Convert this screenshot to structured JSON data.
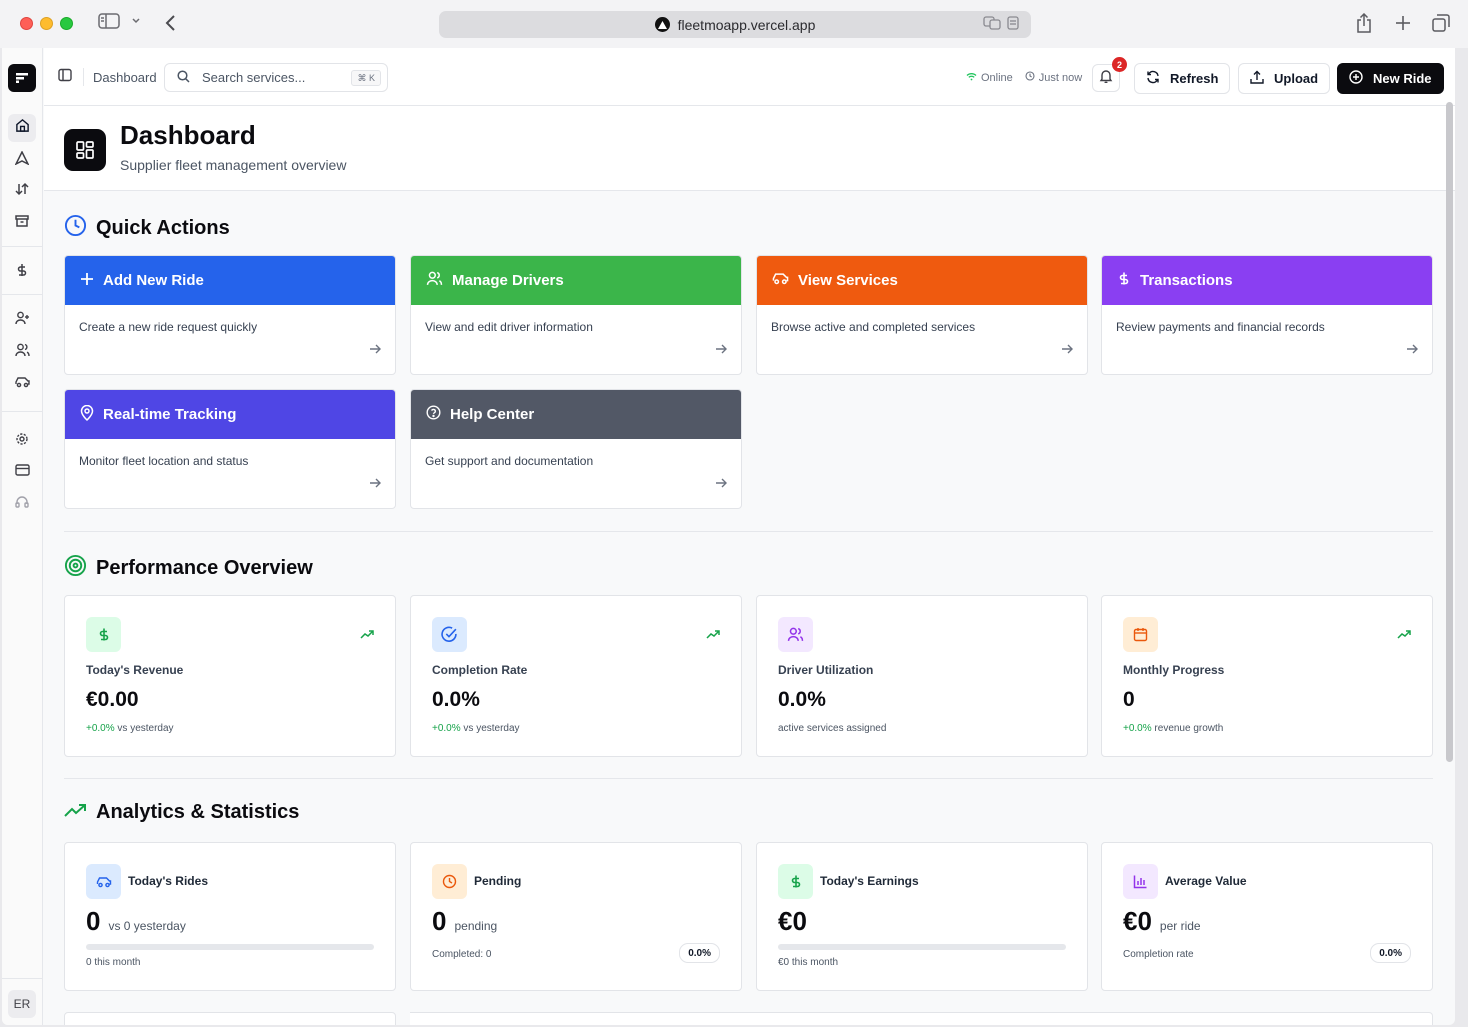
{
  "browser": {
    "url": "fleetmoapp.vercel.app"
  },
  "sidebar": {
    "avatar_initials": "ER",
    "items": [
      {
        "icon": "home-icon",
        "active": true
      },
      {
        "icon": "navigation-icon"
      },
      {
        "icon": "arrows-up-down-icon"
      },
      {
        "icon": "archive-icon"
      },
      {
        "icon": "dollar-icon"
      },
      {
        "icon": "user-plus-icon"
      },
      {
        "icon": "users-icon"
      },
      {
        "icon": "car-icon"
      },
      {
        "icon": "gear-icon"
      },
      {
        "icon": "credit-card-icon"
      },
      {
        "icon": "headset-icon"
      }
    ]
  },
  "topbar": {
    "breadcrumb": "Dashboard",
    "search_placeholder": "Search services...",
    "search_shortcut": "⌘ K",
    "status_online": "Online",
    "status_time": "Just now",
    "notification_count": "2",
    "refresh_label": "Refresh",
    "upload_label": "Upload",
    "new_ride_label": "New Ride"
  },
  "header": {
    "title": "Dashboard",
    "subtitle": "Supplier fleet management overview"
  },
  "quick_actions": {
    "title": "Quick Actions",
    "items": [
      {
        "title": "Add New Ride",
        "desc": "Create a new ride request quickly",
        "color": "#2563eb",
        "icon": "plus-icon"
      },
      {
        "title": "Manage Drivers",
        "desc": "View and edit driver information",
        "color": "#3bb54a",
        "icon": "users-icon"
      },
      {
        "title": "View Services",
        "desc": "Browse active and completed services",
        "color": "#ef5a0f",
        "icon": "car-icon"
      },
      {
        "title": "Transactions",
        "desc": "Review payments and financial records",
        "color": "#8a3ff2",
        "icon": "dollar-icon"
      },
      {
        "title": "Real-time Tracking",
        "desc": "Monitor fleet location and status",
        "color": "#4f46e5",
        "icon": "map-pin-icon"
      },
      {
        "title": "Help Center",
        "desc": "Get support and documentation",
        "color": "#525866",
        "icon": "help-circle-icon"
      }
    ]
  },
  "performance": {
    "title": "Performance Overview",
    "cards": [
      {
        "label": "Today's Revenue",
        "value": "€0.00",
        "delta": "+0.0%",
        "foot": "vs yesterday",
        "icon": "dollar-icon",
        "icon_bg": "#dcfce7",
        "icon_color": "#16a34a",
        "trend": true
      },
      {
        "label": "Completion Rate",
        "value": "0.0%",
        "delta": "+0.0%",
        "foot": "vs yesterday",
        "icon": "check-circle-icon",
        "icon_bg": "#dbeafe",
        "icon_color": "#2563eb",
        "trend": true
      },
      {
        "label": "Driver Utilization",
        "value": "0.0%",
        "delta": "",
        "foot": "active services assigned",
        "icon": "users-icon",
        "icon_bg": "#f3e8ff",
        "icon_color": "#9333ea",
        "trend": false
      },
      {
        "label": "Monthly Progress",
        "value": "0",
        "delta": "+0.0%",
        "foot": "revenue growth",
        "icon": "calendar-icon",
        "icon_bg": "#ffedd5",
        "icon_color": "#ea580c",
        "trend": true
      }
    ]
  },
  "analytics": {
    "title": "Analytics & Statistics",
    "cards": [
      {
        "label": "Today's Rides",
        "value": "0",
        "suffix": "vs 0 yesterday",
        "foot": "0 this month",
        "progress": 0,
        "icon": "car-icon",
        "icon_bg": "#dbeafe",
        "icon_color": "#2563eb"
      },
      {
        "label": "Pending",
        "value": "0",
        "suffix": "pending",
        "foot": "Completed: 0",
        "pill": "0.0%",
        "icon": "clock-icon",
        "icon_bg": "#ffedd5",
        "icon_color": "#ea580c"
      },
      {
        "label": "Today's Earnings",
        "value": "€0",
        "suffix": "",
        "foot": "€0 this month",
        "progress": 0,
        "icon": "dollar-icon",
        "icon_bg": "#dcfce7",
        "icon_color": "#16a34a"
      },
      {
        "label": "Average Value",
        "value": "€0",
        "suffix": "per ride",
        "foot": "Completion rate",
        "pill": "0.0%",
        "icon": "bar-chart-icon",
        "icon_bg": "#f3e8ff",
        "icon_color": "#9333ea"
      }
    ]
  }
}
